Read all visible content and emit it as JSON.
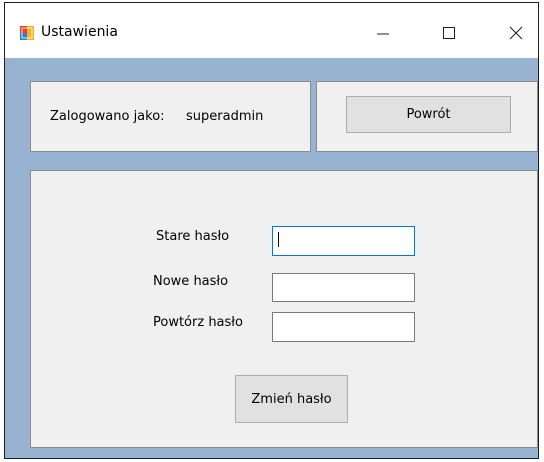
{
  "window": {
    "title": "Ustawienia",
    "icons": {
      "app": "app-icon",
      "minimize": "minimize-icon",
      "maximize": "maximize-icon",
      "close": "close-icon"
    },
    "glyphs": {
      "minimize": "—",
      "maximize": "☐",
      "close": "✕"
    }
  },
  "session": {
    "logged_in_label": "Zalogowano jako:",
    "username": "superadmin",
    "back_button": "Powrót"
  },
  "password_form": {
    "old_password_label": "Stare hasło",
    "old_password_value": "",
    "new_password_label": "Nowe hasło",
    "new_password_value": "",
    "repeat_password_label": "Powtórz hasło",
    "repeat_password_value": "",
    "change_button": "Zmień hasło"
  },
  "colors": {
    "client_background": "#98b3d1",
    "panel_background": "#f0f0f0",
    "focus_border": "#0078d7"
  }
}
